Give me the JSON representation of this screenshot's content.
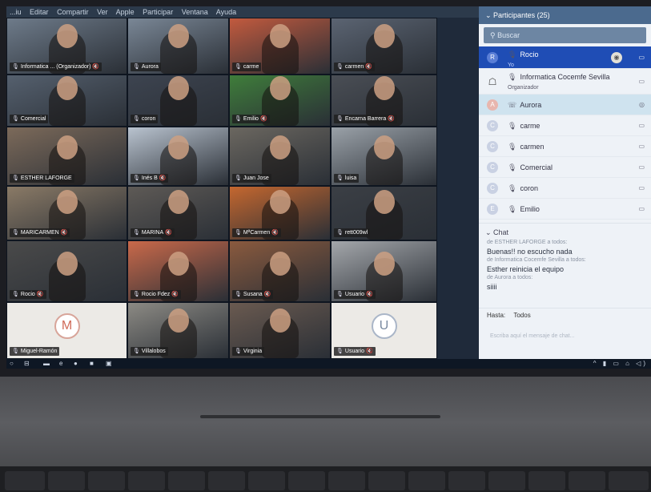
{
  "menubar": [
    "...iu",
    "Editar",
    "Compartir",
    "Ver",
    "Apple",
    "Participar",
    "Ventana",
    "Ayuda"
  ],
  "tiles": [
    {
      "name": "Informatica ... (Organizador)",
      "muted": true,
      "bg": "#6e7b8a"
    },
    {
      "name": "Aurora",
      "muted": false,
      "bg": "#7a8796"
    },
    {
      "name": "carme",
      "muted": false,
      "bg": "#c25a3e"
    },
    {
      "name": "carmen",
      "muted": true,
      "bg": "#5b6472"
    },
    {
      "name": "Comercial",
      "muted": false,
      "bg": "#55606e"
    },
    {
      "name": "coron",
      "muted": false,
      "bg": "#3d4450"
    },
    {
      "name": "Emilio",
      "muted": true,
      "bg": "#3f7d3b"
    },
    {
      "name": "Encarna Barrera",
      "muted": true,
      "bg": "#4a4e55"
    },
    {
      "name": "ESTHER LAFORGE",
      "muted": false,
      "bg": "#7c6a5a"
    },
    {
      "name": "Inés B",
      "muted": true,
      "bg": "#b9c3cf"
    },
    {
      "name": "Juan Jose",
      "muted": false,
      "bg": "#6b6760"
    },
    {
      "name": "luisa",
      "muted": false,
      "bg": "#9aa1a8"
    },
    {
      "name": "MARICARMEN",
      "muted": true,
      "bg": "#8a7a66"
    },
    {
      "name": "MARINA",
      "muted": true,
      "bg": "#5e5a56"
    },
    {
      "name": "MªCarmen",
      "muted": true,
      "bg": "#c4672f"
    },
    {
      "name": "rett009wl",
      "muted": false,
      "bg": "#3b3f45"
    },
    {
      "name": "Rocio",
      "muted": true,
      "bg": "#4a4a4a"
    },
    {
      "name": "Rocio Fdez",
      "muted": true,
      "bg": "#c9694a"
    },
    {
      "name": "Susana",
      "muted": true,
      "bg": "#8a5a3e"
    },
    {
      "name": "Usuario",
      "muted": true,
      "bg": "#a4a7ab"
    },
    {
      "name": "Miguel-Ramón",
      "muted": false,
      "bg": "#eceae6",
      "initial": "M"
    },
    {
      "name": "Villalobos",
      "muted": false,
      "bg": "#8c8a84"
    },
    {
      "name": "Virginia",
      "muted": false,
      "bg": "#6a5a50"
    },
    {
      "name": "Usuario",
      "muted": true,
      "bg": "#eceae6",
      "initial": "U"
    }
  ],
  "sidebar": {
    "header": "Participantes (25)",
    "search_placeholder": "Buscar",
    "me": {
      "initial": "R",
      "name": "Rocio",
      "sub": "Yo"
    },
    "organizer": {
      "name": "Informatica Cocemfe Sevilla",
      "sub": "Organizador"
    },
    "participants": [
      {
        "initial": "A",
        "name": "Aurora",
        "highlight": true
      },
      {
        "initial": "C",
        "name": "carme"
      },
      {
        "initial": "C",
        "name": "carmen"
      },
      {
        "initial": "C",
        "name": "Comercial"
      },
      {
        "initial": "C",
        "name": "coron"
      },
      {
        "initial": "E",
        "name": "Emilio"
      }
    ],
    "chat_header": "Chat",
    "chat": [
      {
        "from": "de ESTHER LAFORGE a todos:",
        "msg": "Buenas!! no escucho nada"
      },
      {
        "from": "de Informatica Cocemfe Sevilla a todos:",
        "msg": "Esther reinicia el equipo"
      },
      {
        "from": "de Aurora a todos:",
        "msg": "siiii"
      }
    ],
    "chat_to_label": "Hasta:",
    "chat_to_value": "Todos",
    "chat_input_placeholder": "Escriba aquí el mensaje de chat..."
  },
  "accent": "#1f4db5"
}
